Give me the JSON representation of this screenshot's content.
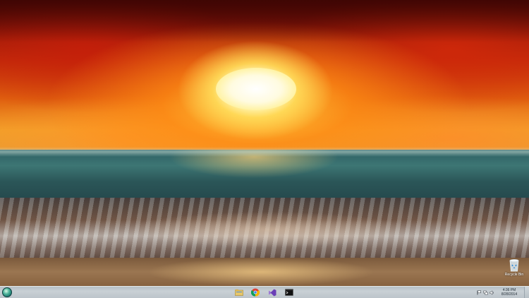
{
  "desktop": {
    "icons": [
      {
        "label": "Recycle Bin",
        "icon": "recycle-bin-icon"
      }
    ]
  },
  "taskbar": {
    "start_icon": "windows-orb-icon",
    "pinned": [
      {
        "name": "file-explorer-icon",
        "color": "#e7c66a"
      },
      {
        "name": "chrome-icon",
        "color": "#db4437"
      },
      {
        "name": "visual-studio-icon",
        "color": "#8661c5"
      },
      {
        "name": "terminal-icon",
        "color": "#111111"
      }
    ],
    "tray": {
      "icons": [
        "flag-icon",
        "network-icon",
        "volume-icon"
      ],
      "time": "4:36 PM",
      "date": "8/28/2014"
    }
  }
}
